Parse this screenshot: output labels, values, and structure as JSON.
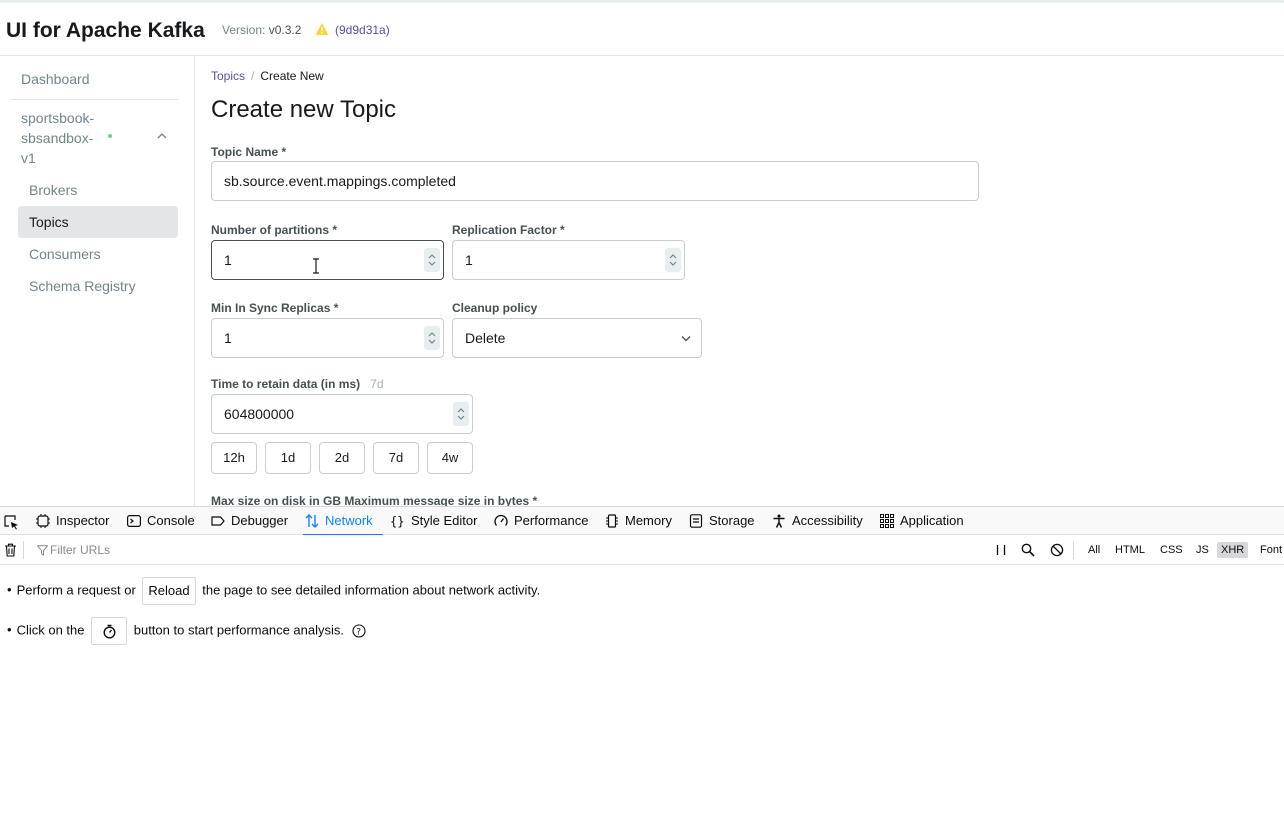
{
  "app": {
    "title": "UI for Apache Kafka",
    "version_label": "Version:",
    "version": "v0.3.2",
    "commit": "(9d9d31a)"
  },
  "sidebar": {
    "dashboard": "Dashboard",
    "cluster_name": "sportsbook-sbsandbox-v1",
    "cluster_lines": [
      "sportsbook-",
      "sbsandbox-",
      "v1"
    ],
    "items": [
      {
        "label": "Brokers",
        "active": false
      },
      {
        "label": "Topics",
        "active": true
      },
      {
        "label": "Consumers",
        "active": false
      },
      {
        "label": "Schema Registry",
        "active": false
      }
    ]
  },
  "breadcrumb": {
    "parent": "Topics",
    "separator": "/",
    "current": "Create New"
  },
  "form": {
    "title": "Create new Topic",
    "topic_name": {
      "label": "Topic Name *",
      "value": "sb.source.event.mappings.completed"
    },
    "partitions": {
      "label": "Number of partitions *",
      "value": "1"
    },
    "replication": {
      "label": "Replication Factor *",
      "value": "1"
    },
    "min_isr": {
      "label": "Min In Sync Replicas *",
      "value": "1"
    },
    "cleanup": {
      "label": "Cleanup policy",
      "value": "Delete"
    },
    "retention": {
      "label": "Time to retain data (in ms)",
      "hint": "7d",
      "value": "604800000"
    },
    "presets": [
      "12h",
      "1d",
      "2d",
      "7d",
      "4w"
    ],
    "next_labels": "Max size on disk in GB  Maximum message size in bytes *"
  },
  "devtools": {
    "tabs": [
      {
        "label": "Inspector",
        "icon": "inspector-icon"
      },
      {
        "label": "Console",
        "icon": "console-icon"
      },
      {
        "label": "Debugger",
        "icon": "debugger-icon"
      },
      {
        "label": "Network",
        "icon": "network-icon",
        "active": true
      },
      {
        "label": "Style Editor",
        "icon": "style-editor-icon"
      },
      {
        "label": "Performance",
        "icon": "performance-icon"
      },
      {
        "label": "Memory",
        "icon": "memory-icon"
      },
      {
        "label": "Storage",
        "icon": "storage-icon"
      },
      {
        "label": "Accessibility",
        "icon": "accessibility-icon"
      },
      {
        "label": "Application",
        "icon": "application-icon"
      }
    ],
    "filter_placeholder": "Filter URLs",
    "type_filters": [
      "All",
      "HTML",
      "CSS",
      "JS",
      "XHR",
      "Font"
    ],
    "selected_type": "XHR",
    "msg1_pre": "Perform a request or",
    "msg1_btn": "Reload",
    "msg1_post": "the page to see detailed information about network activity.",
    "msg2_pre": "Click on the",
    "msg2_post": "button to start performance analysis.",
    "accent": "#0a84ff"
  }
}
